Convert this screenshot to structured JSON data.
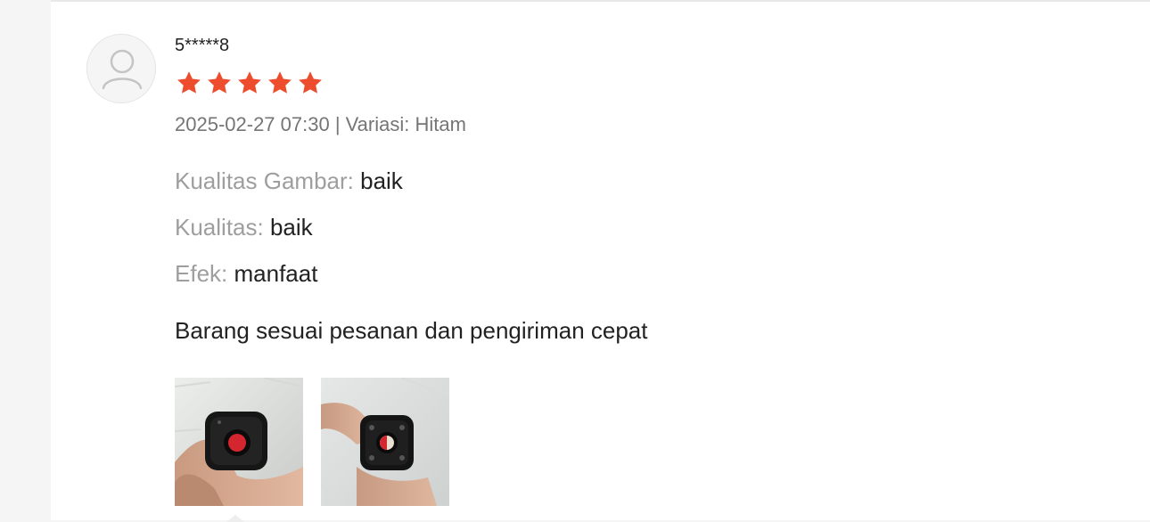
{
  "review": {
    "username": "5*****8",
    "rating": 5,
    "rating_max": 5,
    "meta": "2025-02-27 07:30 | Variasi: Hitam",
    "attributes": [
      {
        "label": "Kualitas Gambar:",
        "value": "baik"
      },
      {
        "label": "Kualitas:",
        "value": "baik"
      },
      {
        "label": "Efek:",
        "value": "manfaat"
      }
    ],
    "comment": "Barang sesuai pesanan dan pengiriman cepat",
    "photo_count": 2
  },
  "icons": {
    "avatar": "user-placeholder-icon",
    "star": "star-icon"
  },
  "colors": {
    "star": "#ee4d2d",
    "text_primary": "#222222",
    "text_secondary": "#757575",
    "label": "#9e9e9e"
  }
}
